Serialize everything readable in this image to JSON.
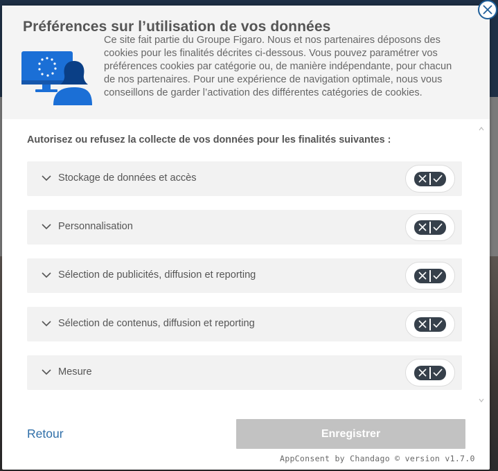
{
  "modal": {
    "title": "Préférences sur l’utilisation de vos données",
    "description": "Ce site fait partie du Groupe Figaro. Nous et nos partenaires déposons des cookies pour les finalités décrites ci-dessous.  Vous pouvez paramétrer vos préférences cookies par catégorie ou, de manière indépendante, pour chacun de nos partenaires. Pour une expérience de navigation optimale, nous vous conseillons de garder l’activation des différentes catégories de cookies.",
    "close_icon": "close-icon",
    "illustration_icon": "eu-user-computer-icon"
  },
  "body": {
    "intro": "Autorisez ou refusez la collecte de vos données pour les finalités suivantes :",
    "categories": [
      {
        "label": "Stockage de données et accès",
        "state": "undecided"
      },
      {
        "label": "Personnalisation",
        "state": "undecided"
      },
      {
        "label": "Sélection de publicités, diffusion et reporting",
        "state": "undecided"
      },
      {
        "label": "Sélection de contenus, diffusion et reporting",
        "state": "undecided"
      },
      {
        "label": "Mesure",
        "state": "undecided"
      }
    ]
  },
  "footer": {
    "back_label": "Retour",
    "save_label": "Enregistrer",
    "credit": "AppConsent by Chandago © version v1.7.0"
  },
  "colors": {
    "accent": "#2e6ea8",
    "title": "#555555",
    "toggle_dark": "#36404b",
    "disabled_button": "#c2c2c2",
    "row_bg": "#f2f2f2"
  }
}
